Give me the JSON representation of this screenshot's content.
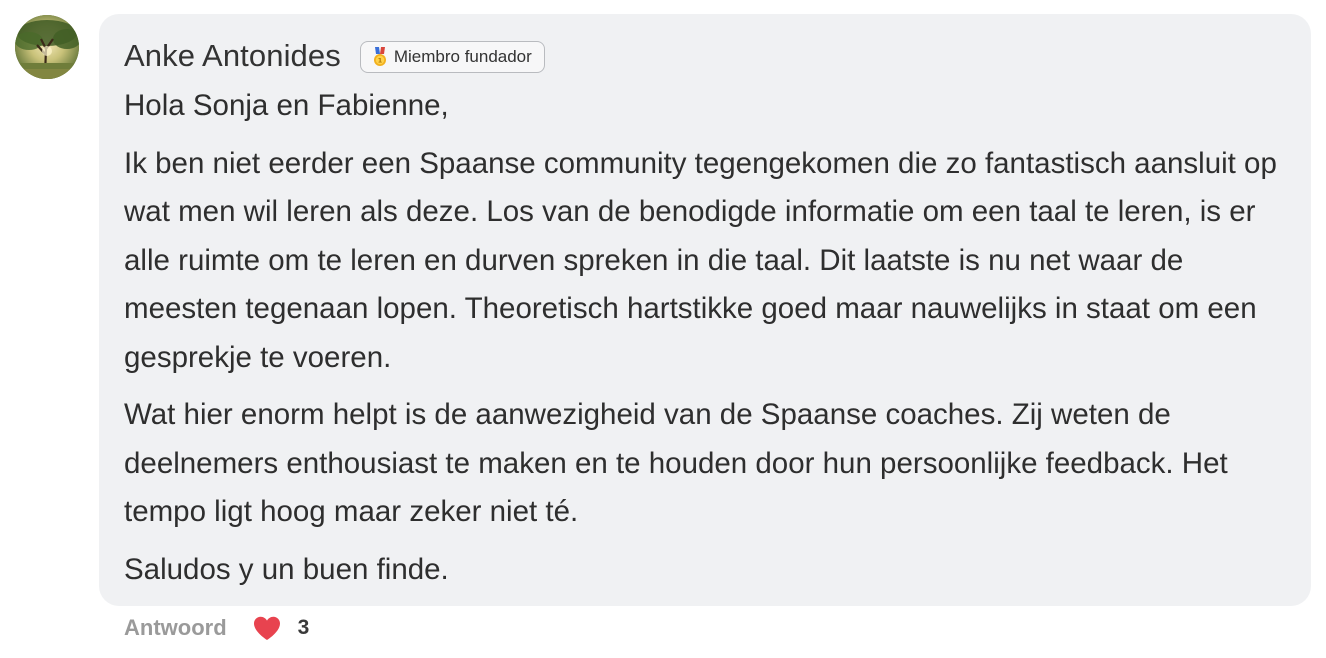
{
  "comment": {
    "author": "Anke Antonides",
    "badge": {
      "icon": "medal-icon",
      "label": "Miembro fundador"
    },
    "paragraphs": [
      "Hola Sonja en Fabienne,",
      "Ik ben niet eerder een Spaanse community tegengekomen die zo fantastisch aansluit op wat men wil leren als deze. Los van de benodigde informatie om een taal te leren, is er alle ruimte om te leren en durven spreken in die taal. Dit laatste is nu net waar de meesten tegenaan lopen. Theoretisch hartstikke goed maar nauwelijks in staat om een gesprekje te voeren.",
      "Wat hier enorm helpt is de aanwezigheid van de Spaanse coaches. Zij weten de deelnemers enthousiast te maken en te houden door hun persoonlijke feedback. Het tempo ligt hoog maar zeker niet té.",
      "Saludos y un buen finde."
    ]
  },
  "actions": {
    "reply_label": "Antwoord",
    "like_icon": "heart-icon",
    "like_count": "3"
  },
  "colors": {
    "bubble_bg": "#f0f1f3",
    "heart": "#e8434f",
    "muted_text": "#9a9a9a"
  }
}
